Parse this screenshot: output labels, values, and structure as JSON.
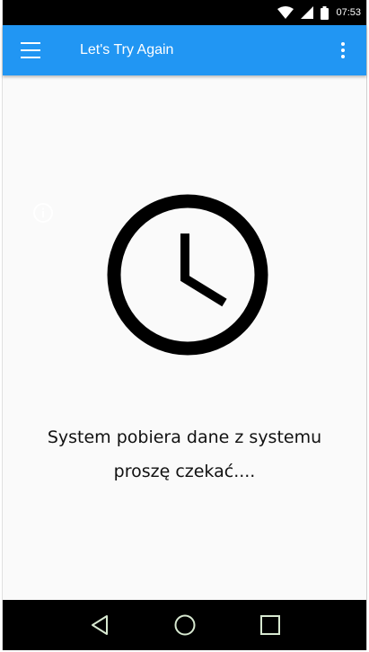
{
  "status_bar": {
    "time": "07:53"
  },
  "app_bar": {
    "title": "Let's Try Again"
  },
  "content": {
    "message_line1": "System pobiera dane z systemu",
    "message_line2": "proszę czekać...."
  },
  "colors": {
    "app_bar": "#2196f3",
    "background": "#fafafa",
    "nav_icons": "#d7e8d0"
  },
  "icons": [
    "wifi-icon",
    "signal-icon",
    "battery-icon",
    "menu-icon",
    "more-vert-icon",
    "info-icon",
    "clock-icon",
    "back-icon",
    "home-icon",
    "recents-icon"
  ]
}
